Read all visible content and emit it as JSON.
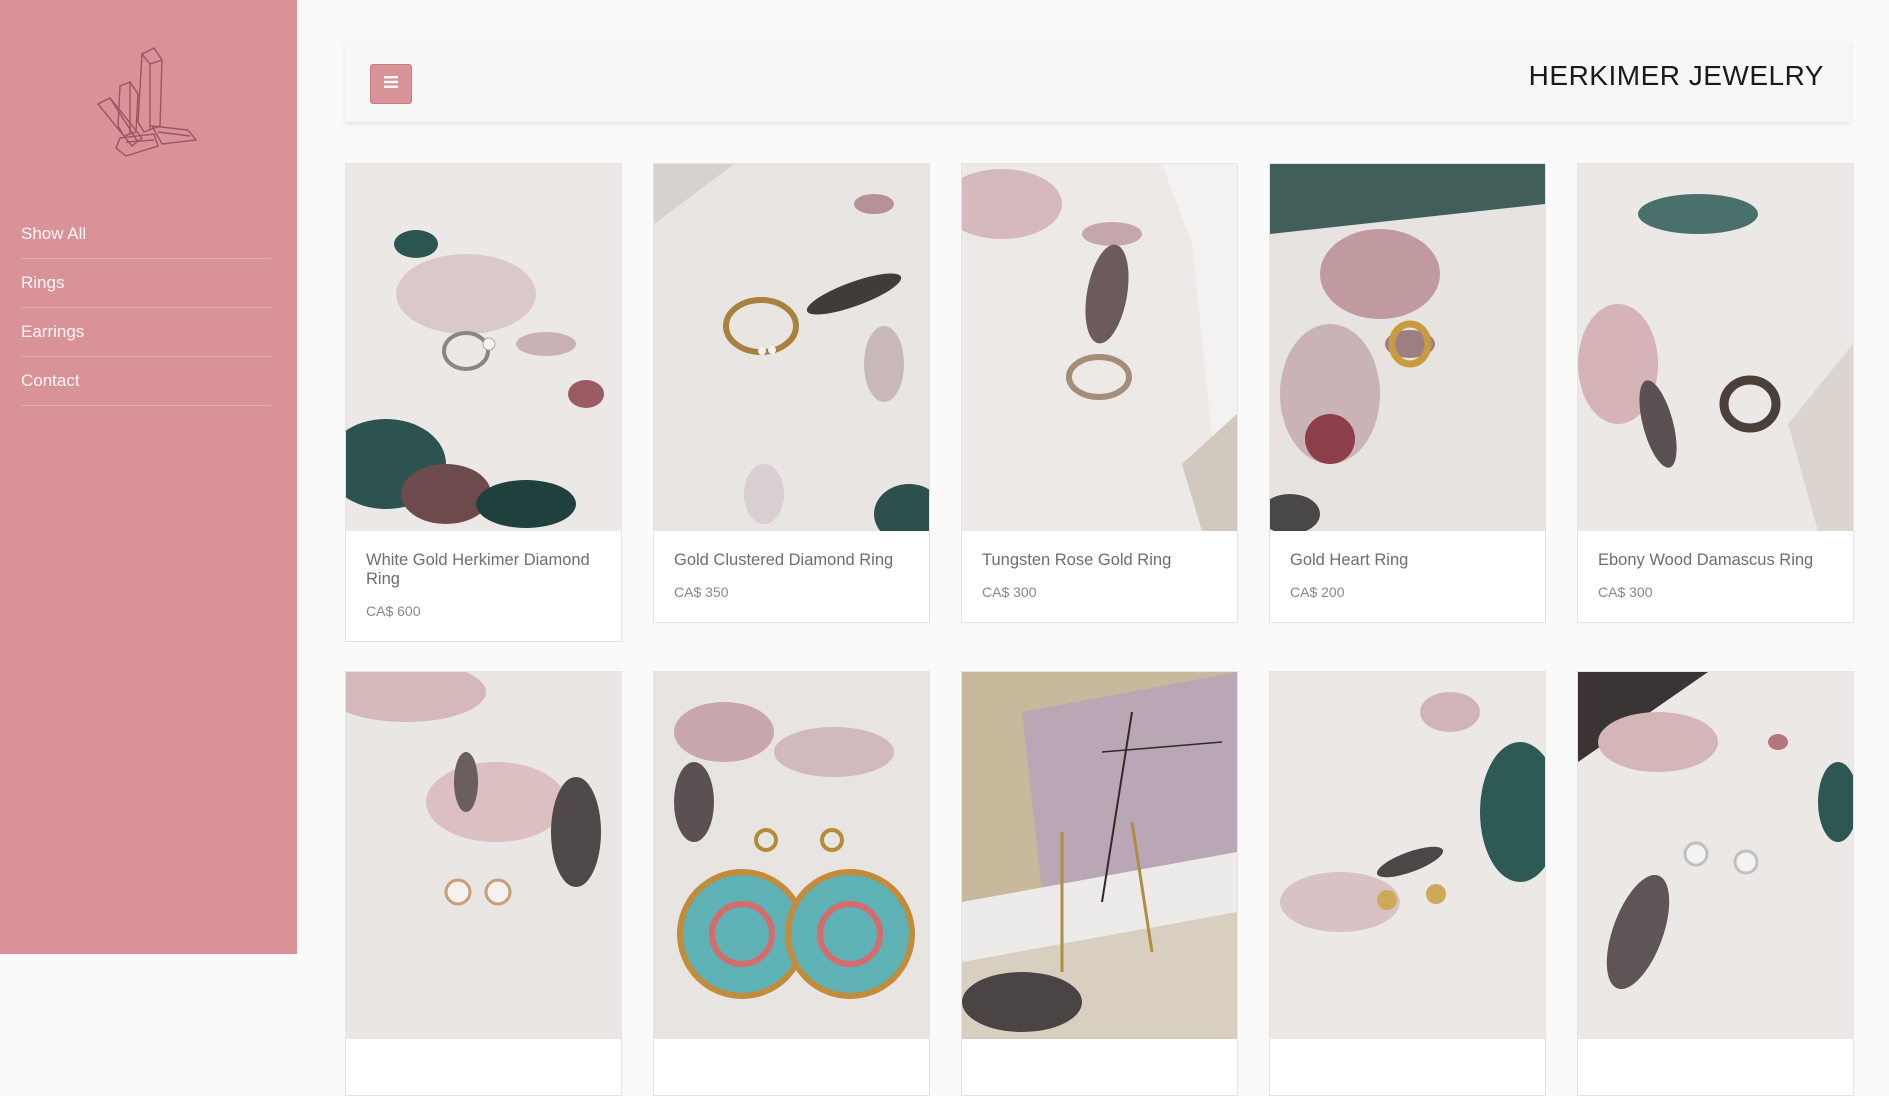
{
  "sidebar": {
    "nav": [
      {
        "label": "Show All"
      },
      {
        "label": "Rings"
      },
      {
        "label": "Earrings"
      },
      {
        "label": "Contact"
      }
    ]
  },
  "header": {
    "brand": "HERKIMER JEWELRY"
  },
  "products": [
    {
      "name": "White Gold Herkimer Diamond Ring",
      "price": "CA$ 600"
    },
    {
      "name": "Gold Clustered Diamond Ring",
      "price": "CA$ 350"
    },
    {
      "name": "Tungsten Rose Gold Ring",
      "price": "CA$ 300"
    },
    {
      "name": "Gold Heart Ring",
      "price": "CA$ 200"
    },
    {
      "name": "Ebony Wood Damascus Ring",
      "price": "CA$ 300"
    },
    {
      "name": "",
      "price": ""
    },
    {
      "name": "",
      "price": ""
    },
    {
      "name": "",
      "price": ""
    },
    {
      "name": "",
      "price": ""
    },
    {
      "name": "",
      "price": ""
    }
  ],
  "colors": {
    "sidebar": "#d99297",
    "accent": "#d99297",
    "background": "#fafafa"
  },
  "icons": {
    "logo": "crystal-logo-icon",
    "menu": "hamburger-menu-icon"
  }
}
